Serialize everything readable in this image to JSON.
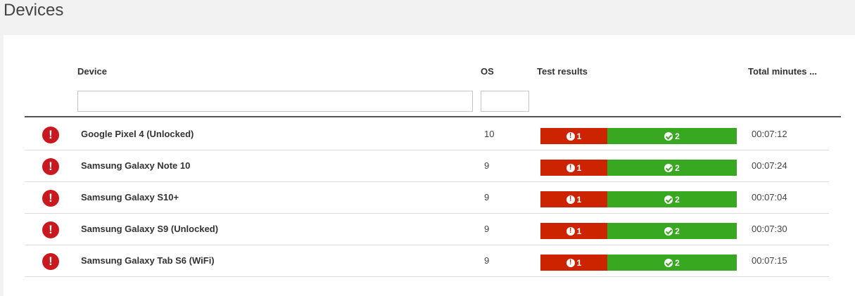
{
  "page": {
    "title": "Devices"
  },
  "table": {
    "headers": {
      "device": "Device",
      "os": "OS",
      "test_results": "Test results",
      "total_minutes": "Total minutes ..."
    },
    "filters": {
      "device_value": "",
      "os_value": ""
    },
    "rows": [
      {
        "status_icon": "error-icon",
        "device": "Google Pixel 4 (Unlocked)",
        "os": "10",
        "failed": "1",
        "passed": "2",
        "minutes": "00:07:12"
      },
      {
        "status_icon": "error-icon",
        "device": "Samsung Galaxy Note 10",
        "os": "9",
        "failed": "1",
        "passed": "2",
        "minutes": "00:07:24"
      },
      {
        "status_icon": "error-icon",
        "device": "Samsung Galaxy S10+",
        "os": "9",
        "failed": "1",
        "passed": "2",
        "minutes": "00:07:04"
      },
      {
        "status_icon": "error-icon",
        "device": "Samsung Galaxy S9 (Unlocked)",
        "os": "9",
        "failed": "1",
        "passed": "2",
        "minutes": "00:07:30"
      },
      {
        "status_icon": "error-icon",
        "device": "Samsung Galaxy Tab S6 (WiFi)",
        "os": "9",
        "failed": "1",
        "passed": "2",
        "minutes": "00:07:15"
      }
    ]
  },
  "colors": {
    "fail": "#cc2300",
    "pass": "#38a820",
    "error_icon": "#c9191e"
  }
}
